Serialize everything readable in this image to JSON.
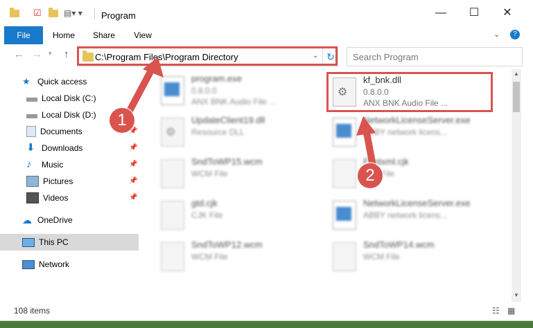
{
  "window": {
    "title": "Program",
    "controls": {
      "minimize": "—",
      "maximize": "☐",
      "close": "✕"
    }
  },
  "ribbon": {
    "tabs": [
      {
        "label": "File"
      },
      {
        "label": "Home"
      },
      {
        "label": "Share"
      },
      {
        "label": "View"
      }
    ],
    "help": "?"
  },
  "address": {
    "path": "C:\\Program Files\\Program Directory",
    "search_placeholder": "Search Program"
  },
  "sidebar": {
    "items": [
      {
        "label": "Quick access",
        "icon": "star-icon"
      },
      {
        "label": "Local Disk (C:)",
        "icon": "drive-icon"
      },
      {
        "label": "Local Disk (D:)",
        "icon": "drive-icon"
      },
      {
        "label": "Documents",
        "icon": "documents-icon"
      },
      {
        "label": "Downloads",
        "icon": "download-icon"
      },
      {
        "label": "Music",
        "icon": "music-icon"
      },
      {
        "label": "Pictures",
        "icon": "pictures-icon"
      },
      {
        "label": "Videos",
        "icon": "videos-icon"
      },
      {
        "label": "OneDrive",
        "icon": "cloud-icon"
      },
      {
        "label": "This PC",
        "icon": "computer-icon"
      },
      {
        "label": "Network",
        "icon": "network-icon"
      }
    ]
  },
  "files": [
    {
      "name": "program.exe",
      "line2": "0.8.0.0",
      "line3": "ANX BNK Audio File ...",
      "icon": "exe"
    },
    {
      "name": "kf_bnk.dll",
      "line2": "0.8.0.0",
      "line3": "ANX BNK Audio File ...",
      "icon": "dll"
    },
    {
      "name": "UpdateClient19.dll",
      "line2": "Resource DLL",
      "line3": "",
      "icon": "dll"
    },
    {
      "name": "NetworkLicenseServer.exe",
      "line2": "ABBY network licens...",
      "line3": "",
      "icon": "exe"
    },
    {
      "name": "SndToWP15.wcm",
      "line2": "WCM File",
      "line3": "",
      "icon": "doc"
    },
    {
      "name": "Fontxml.cjk",
      "line2": "CJK File",
      "line3": "",
      "icon": "doc"
    },
    {
      "name": "gtd.cjk",
      "line2": "CJK File",
      "line3": "",
      "icon": "doc"
    },
    {
      "name": "NetworkLicenseServer.exe",
      "line2": "ABBY network licens...",
      "line3": "",
      "icon": "exe"
    },
    {
      "name": "SndToWP12.wcm",
      "line2": "WCM File",
      "line3": "",
      "icon": "doc"
    },
    {
      "name": "SndToWP14.wcm",
      "line2": "WCM File",
      "line3": "",
      "icon": "doc"
    }
  ],
  "status": {
    "items_count": "108 items"
  },
  "callouts": [
    {
      "number": "1"
    },
    {
      "number": "2"
    }
  ],
  "colors": {
    "accent": "#1979ca",
    "highlight": "#d9534f"
  }
}
